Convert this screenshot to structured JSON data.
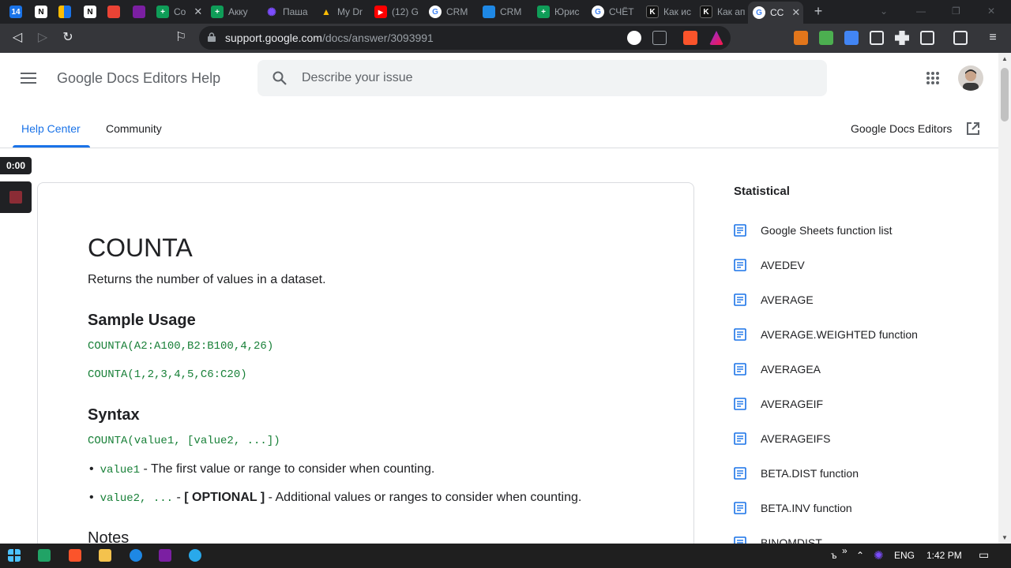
{
  "browser": {
    "tabs": [
      {
        "label": "",
        "icon": "calendar-icon",
        "color": "#1a73e8"
      },
      {
        "label": "",
        "icon": "notion-icon",
        "color": "#ffffff"
      },
      {
        "label": "",
        "icon": "google-play-icon",
        "color": "#fbbc04"
      },
      {
        "label": "",
        "icon": "notion-icon",
        "color": "#ffffff"
      },
      {
        "label": "",
        "icon": "app-icon",
        "color": "#ea4335"
      },
      {
        "label": "",
        "icon": "app-icon",
        "color": "#7b1fa2"
      },
      {
        "label": "Со",
        "icon": "sheets-icon",
        "color": "#0f9d58"
      },
      {
        "label": "Акку",
        "icon": "sheets-icon",
        "color": "#0f9d58"
      },
      {
        "label": "Паша",
        "icon": "gear-icon",
        "color": "#7c4dff"
      },
      {
        "label": "My Dr",
        "icon": "drive-icon",
        "color": "#fbbc04"
      },
      {
        "label": "(12) G",
        "icon": "youtube-icon",
        "color": "#ff0000"
      },
      {
        "label": "CRM",
        "icon": "google-icon",
        "color": "#4285f4"
      },
      {
        "label": "CRM",
        "icon": "app-icon",
        "color": "#1e88e5"
      },
      {
        "label": "Юрис",
        "icon": "sheets-icon",
        "color": "#0f9d58"
      },
      {
        "label": "СЧЁТ",
        "icon": "google-icon",
        "color": "#4285f4"
      },
      {
        "label": "Как ис",
        "icon": "k-icon",
        "color": "#111111"
      },
      {
        "label": "Как ап",
        "icon": "k-icon",
        "color": "#111111"
      },
      {
        "label": "СС",
        "icon": "google-icon",
        "color": "#4285f4"
      }
    ],
    "url_host": "support.google.com",
    "url_path": "/docs/answer/3093991"
  },
  "header": {
    "product_title": "Google Docs Editors Help",
    "search_placeholder": "Describe your issue",
    "nav": [
      "Help Center",
      "Community"
    ],
    "product_link": "Google Docs Editors"
  },
  "recorder": {
    "time": "0:00"
  },
  "article": {
    "title": "COUNTA",
    "description": "Returns the number of values in a dataset.",
    "sample_heading": "Sample Usage",
    "samples": [
      "COUNTA(A2:A100,B2:B100,4,26)",
      "COUNTA(1,2,3,4,5,C6:C20)"
    ],
    "syntax_heading": "Syntax",
    "syntax": "COUNTA(value1, [value2, ...])",
    "params": [
      {
        "code": "value1",
        "sep": " - ",
        "text": "The first value or range to consider when counting."
      },
      {
        "code": "value2, ...",
        "sep": " - ",
        "optional": "[ OPTIONAL ]",
        "text": " - Additional values or ranges to consider when counting."
      }
    ],
    "notes_heading": "Notes"
  },
  "sidebar": {
    "title": "Statistical",
    "items": [
      "Google Sheets function list",
      "AVEDEV",
      "AVERAGE",
      "AVERAGE.WEIGHTED function",
      "AVERAGEA",
      "AVERAGEIF",
      "AVERAGEIFS",
      "BETA.DIST function",
      "BETA.INV function",
      "BINOMDIST"
    ]
  },
  "taskbar": {
    "lang": "ENG",
    "time": "1:42 PM"
  },
  "colors": {
    "accent": "#1a73e8",
    "code": "#188038"
  }
}
